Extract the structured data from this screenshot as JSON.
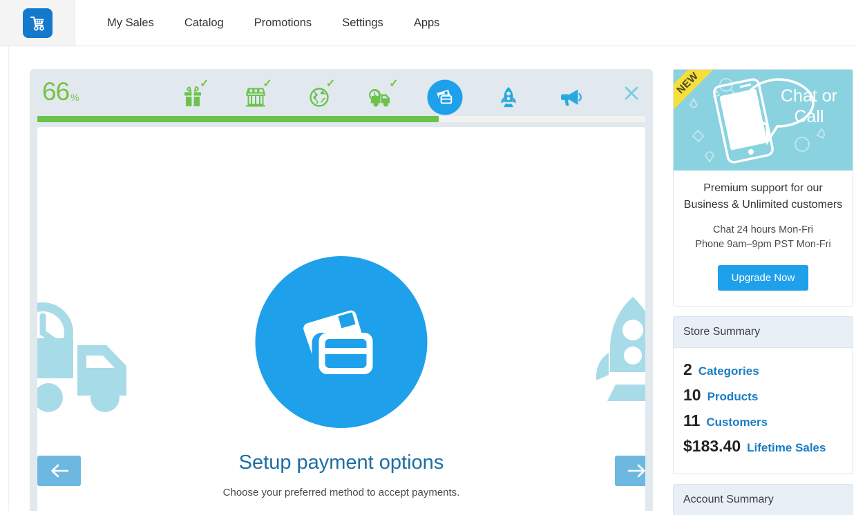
{
  "topnav": {
    "logo_icon": "shopping-cart-icon",
    "links": [
      {
        "label": "My Sales"
      },
      {
        "label": "Catalog"
      },
      {
        "label": "Promotions"
      },
      {
        "label": "Settings"
      },
      {
        "label": "Apps"
      }
    ]
  },
  "wizard": {
    "percent_value": "66",
    "percent_sign": "%",
    "progress_percent": 66,
    "close_icon": "close-x-icon",
    "steps": [
      {
        "id": "gift",
        "icon": "gift-icon",
        "state": "complete",
        "check": "✓"
      },
      {
        "id": "store",
        "icon": "storefront-icon",
        "state": "complete",
        "check": "✓"
      },
      {
        "id": "global",
        "icon": "globe-icon",
        "state": "complete",
        "check": "✓"
      },
      {
        "id": "shipping",
        "icon": "delivery-truck-icon",
        "state": "complete",
        "check": "✓"
      },
      {
        "id": "payment",
        "icon": "credit-cards-icon",
        "state": "active",
        "check": ""
      },
      {
        "id": "launch",
        "icon": "rocket-icon",
        "state": "pending",
        "check": ""
      },
      {
        "id": "market",
        "icon": "megaphone-icon",
        "state": "pending",
        "check": ""
      }
    ],
    "hero": {
      "icon": "credit-cards-icon",
      "title": "Setup payment options",
      "subtitle": "Choose your preferred method to accept payments."
    },
    "prev_icon": "arrow-left-icon",
    "next_icon": "arrow-right-icon",
    "background_art": [
      "delivery-truck-icon",
      "rocket-icon"
    ]
  },
  "sidebar": {
    "promo": {
      "ribbon": "NEW",
      "banner_icon": "phone-chat-bubble-illustration",
      "banner_text": "Chat or Call",
      "headline": "Premium support for our Business & Unlimited customers",
      "line1": "Chat 24 hours Mon-Fri",
      "line2": "Phone 9am–9pm PST Mon-Fri",
      "cta_label": "Upgrade Now"
    },
    "store_summary": {
      "title": "Store Summary",
      "stats": [
        {
          "value": "2",
          "label": "Categories"
        },
        {
          "value": "10",
          "label": "Products"
        },
        {
          "value": "11",
          "label": "Customers"
        },
        {
          "value": "$183.40",
          "label": "Lifetime Sales"
        }
      ]
    },
    "account_summary": {
      "title": "Account Summary"
    }
  },
  "colors": {
    "brand_blue": "#1fa0eb",
    "link_blue": "#1a7cc4",
    "progress_green": "#6cc24a",
    "title_blue": "#1d6ea3",
    "arrow_blue": "#6cb8e0",
    "ribbon_yellow": "#f7de3a",
    "panel_head": "#e8eff7",
    "wizard_bg": "#e1e9ef"
  }
}
